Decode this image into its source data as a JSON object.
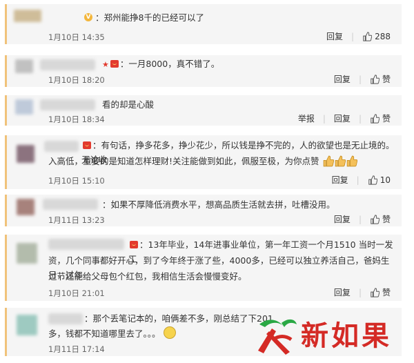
{
  "colors": {
    "accent_border": "#f0c27a",
    "card_bg": "#f5f5f5",
    "brand_red": "#d42a25",
    "name_orange": "#eb7350"
  },
  "comments": [
    {
      "text": "郑州能挣8千的已经可以了",
      "date": "1月10日 14:35",
      "actions": [
        "回复"
      ],
      "likes": "288"
    },
    {
      "text": "一月8000，真不错了。",
      "date": "1月10日 18:20",
      "actions": [
        "回复"
      ],
      "likes": "赞"
    },
    {
      "text": "看的却是心酸",
      "date": "1月10日 18:34",
      "actions": [
        "举报",
        "回复"
      ],
      "likes": "赞"
    },
    {
      "text1": "有句话，挣多花多，挣少花少，所以钱是挣不完的，人的欲望也是无止境的。无论收",
      "text2": "入高低，重要的是知道怎样理财!关注能做到如此，佩服至极，为你点赞",
      "date": "1月10日 15:10",
      "actions": [
        "回复"
      ],
      "likes": "10"
    },
    {
      "text": "如果不厚降低消费水平，想高品质生活就去拼，吐槽没用。",
      "date": "1月11日 13:23",
      "actions": [
        "回复"
      ],
      "likes": "赞"
    },
    {
      "text1": "13年毕业，14年进事业单位，第一年工资一个月1510 当时一发工",
      "text2": "资，几个同事都好开心，到了今年终于涨了些，4000多，已经可以独立养活自己，爸妈生日，过年",
      "text3": "过节还能给父母包个红包，我相信生活会慢慢变好。",
      "date": "1月10日 21:01",
      "actions": [
        "回复"
      ],
      "likes": "赞"
    },
    {
      "text1": "那个丢笔记本的，咱俩差不多，刚总结了下201",
      "text2": "多，钱都不知道哪里去了。。。",
      "date": "1月11日 17:14"
    }
  ],
  "watermark": {
    "text": "新如果",
    "icon": "xinhua-logo-icon"
  }
}
